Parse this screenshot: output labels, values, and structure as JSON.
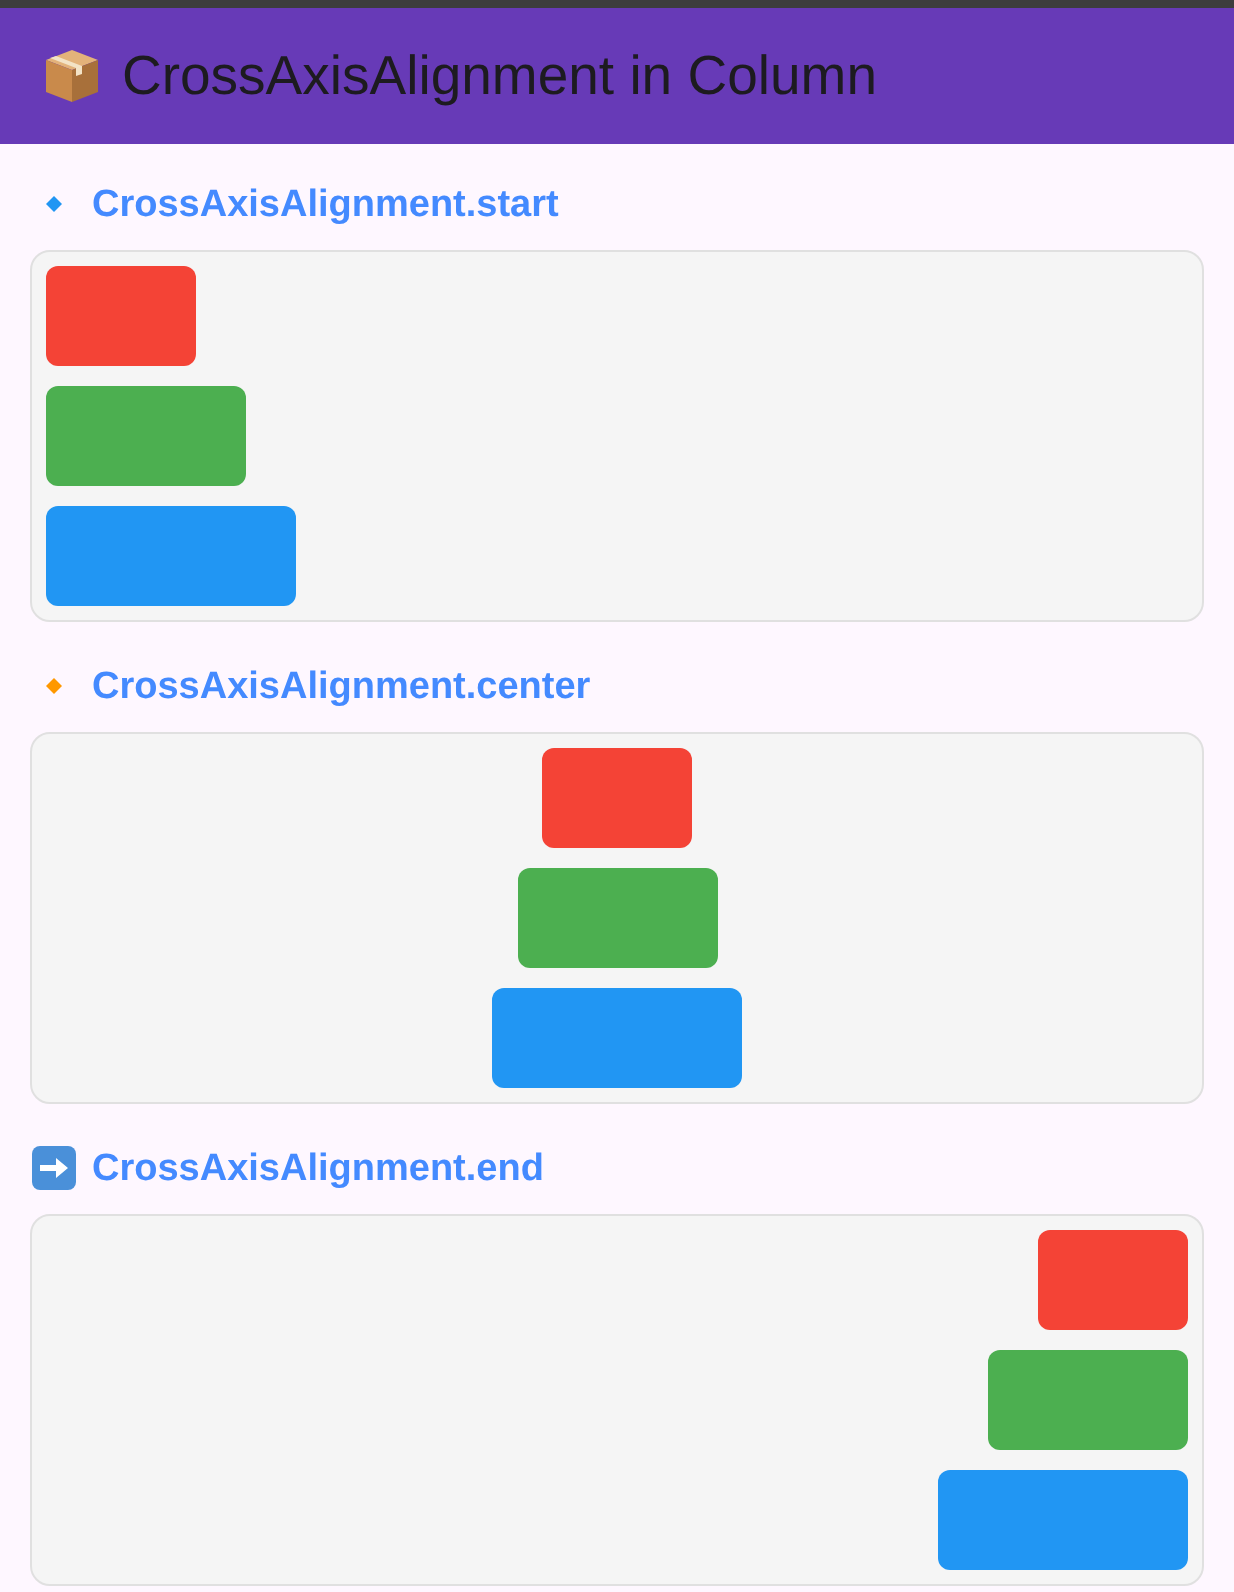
{
  "app_bar": {
    "title": "CrossAxisAlignment in Column"
  },
  "sections": [
    {
      "icon": {
        "kind": "diamond",
        "color": "#2196f3"
      },
      "heading": "CrossAxisAlignment.start",
      "column": {
        "kind": "start",
        "boxes": [
          {
            "color": "#f44336"
          },
          {
            "color": "#4caf50"
          },
          {
            "color": "#2196f3"
          }
        ]
      }
    },
    {
      "icon": {
        "kind": "diamond",
        "color": "#ff9800"
      },
      "heading": "CrossAxisAlignment.center",
      "column": {
        "kind": "center",
        "boxes": [
          {
            "color": "#f44336"
          },
          {
            "color": "#4caf50"
          },
          {
            "color": "#2196f3"
          }
        ]
      }
    },
    {
      "icon": {
        "kind": "arrow"
      },
      "heading": "CrossAxisAlignment.end",
      "column": {
        "kind": "end",
        "boxes": [
          {
            "color": "#f44336"
          },
          {
            "color": "#4caf50"
          },
          {
            "color": "#2196f3"
          }
        ]
      }
    }
  ]
}
